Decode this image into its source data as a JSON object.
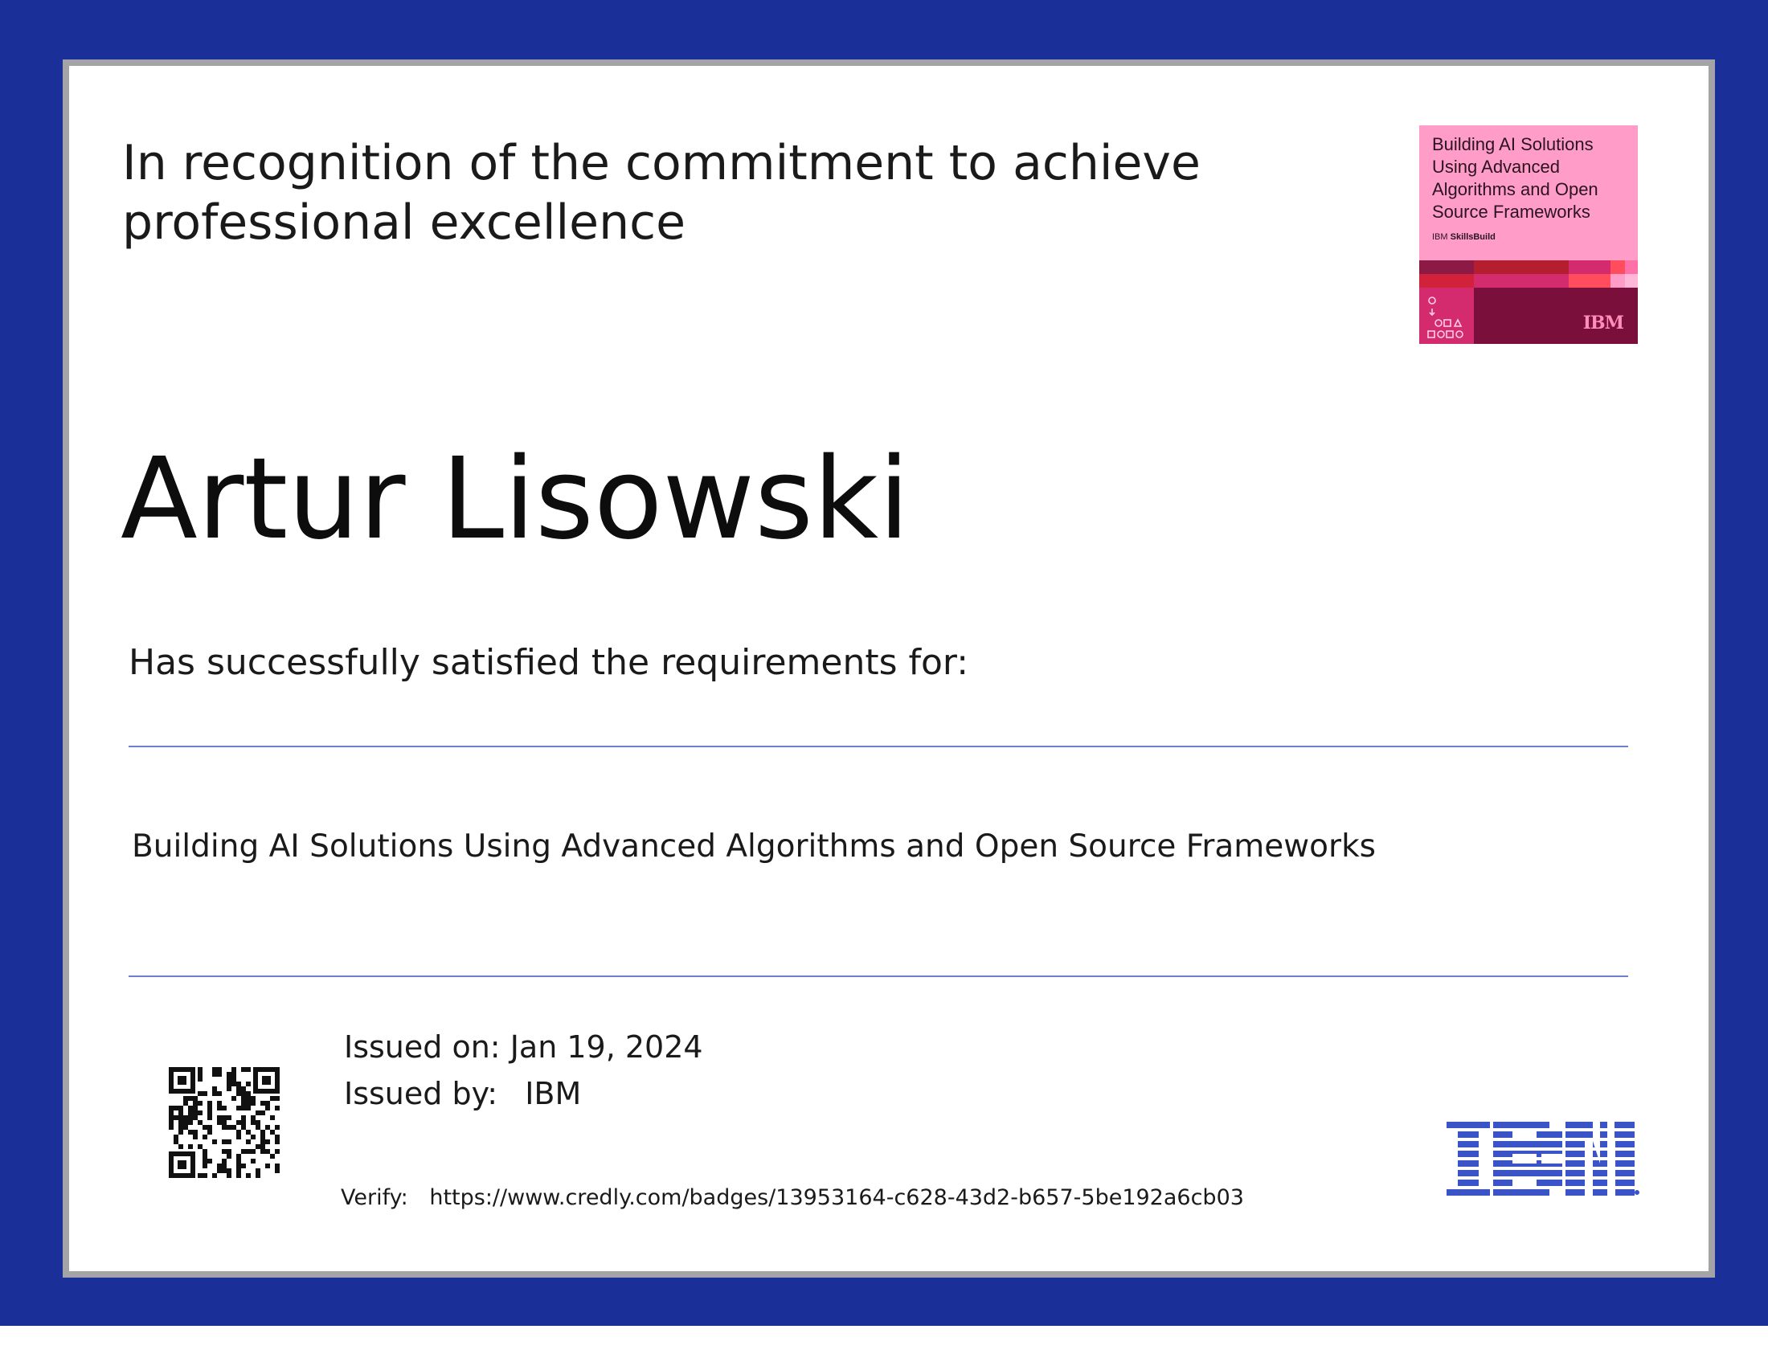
{
  "certificate": {
    "heading": "In recognition of the commitment to achieve professional excellence",
    "recipient": "Artur Lisowski",
    "requirements_text": "Has successfully satisfied the requirements for:",
    "course_title": "Building AI Solutions Using Advanced Algorithms and Open Source Frameworks",
    "issued_on_label": "Issued on:",
    "issued_on_value": "Jan 19, 2024",
    "issued_by_label": "Issued by:",
    "issued_by_value": "IBM",
    "verify_label": "Verify:",
    "verify_url": "https://www.credly.com/badges/13953164-c628-43d2-b657-5be192a6cb03"
  },
  "badge": {
    "title": "Building AI Solutions Using Advanced Algorithms and Open Source Frameworks",
    "issuer_prefix": "IBM",
    "issuer_program": "SkillsBuild",
    "logo_text": "IBM",
    "icon_name": "course-badge-icon"
  },
  "logo": {
    "text": "IBM",
    "icon_name": "ibm-logo-icon"
  },
  "qr": {
    "icon_name": "qr-code-icon"
  },
  "colors": {
    "frame": "#1b2f98",
    "card_border": "#a3a3a8",
    "rule": "#6f7fd0",
    "badge_pink": "#ff9dc8",
    "ibm_blue": "#3a54c8"
  }
}
